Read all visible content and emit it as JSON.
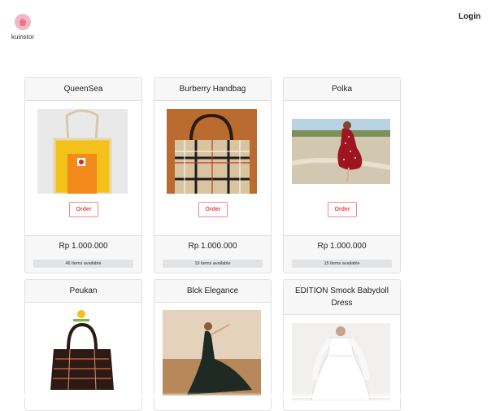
{
  "nav": {
    "brand": "kuinstor",
    "login_label": "Login",
    "logo_icon": "bag-logo-icon"
  },
  "order_label": "Order",
  "products": [
    {
      "name": "QueenSea",
      "price": "Rp 1.000.000",
      "stock": "46 items available",
      "image": "yellow-tote-bag"
    },
    {
      "name": "Burberry Handbag",
      "price": "Rp 1.000.000",
      "stock": "19 items available",
      "image": "plaid-handbag"
    },
    {
      "name": "Polka",
      "price": "Rp 1.000.000",
      "stock": "15 items available",
      "image": "red-polka-dress"
    },
    {
      "name": "Peukan",
      "image": "embroidered-handbag"
    },
    {
      "name": "Blck Elegance",
      "image": "black-gown"
    },
    {
      "name": "EDITION Smock Babydoll Dress",
      "image": "white-dress"
    }
  ],
  "colors": {
    "accent": "#e24a4a",
    "logo_bg": "#f4b8c4",
    "header_bg": "#f7f7f7"
  }
}
